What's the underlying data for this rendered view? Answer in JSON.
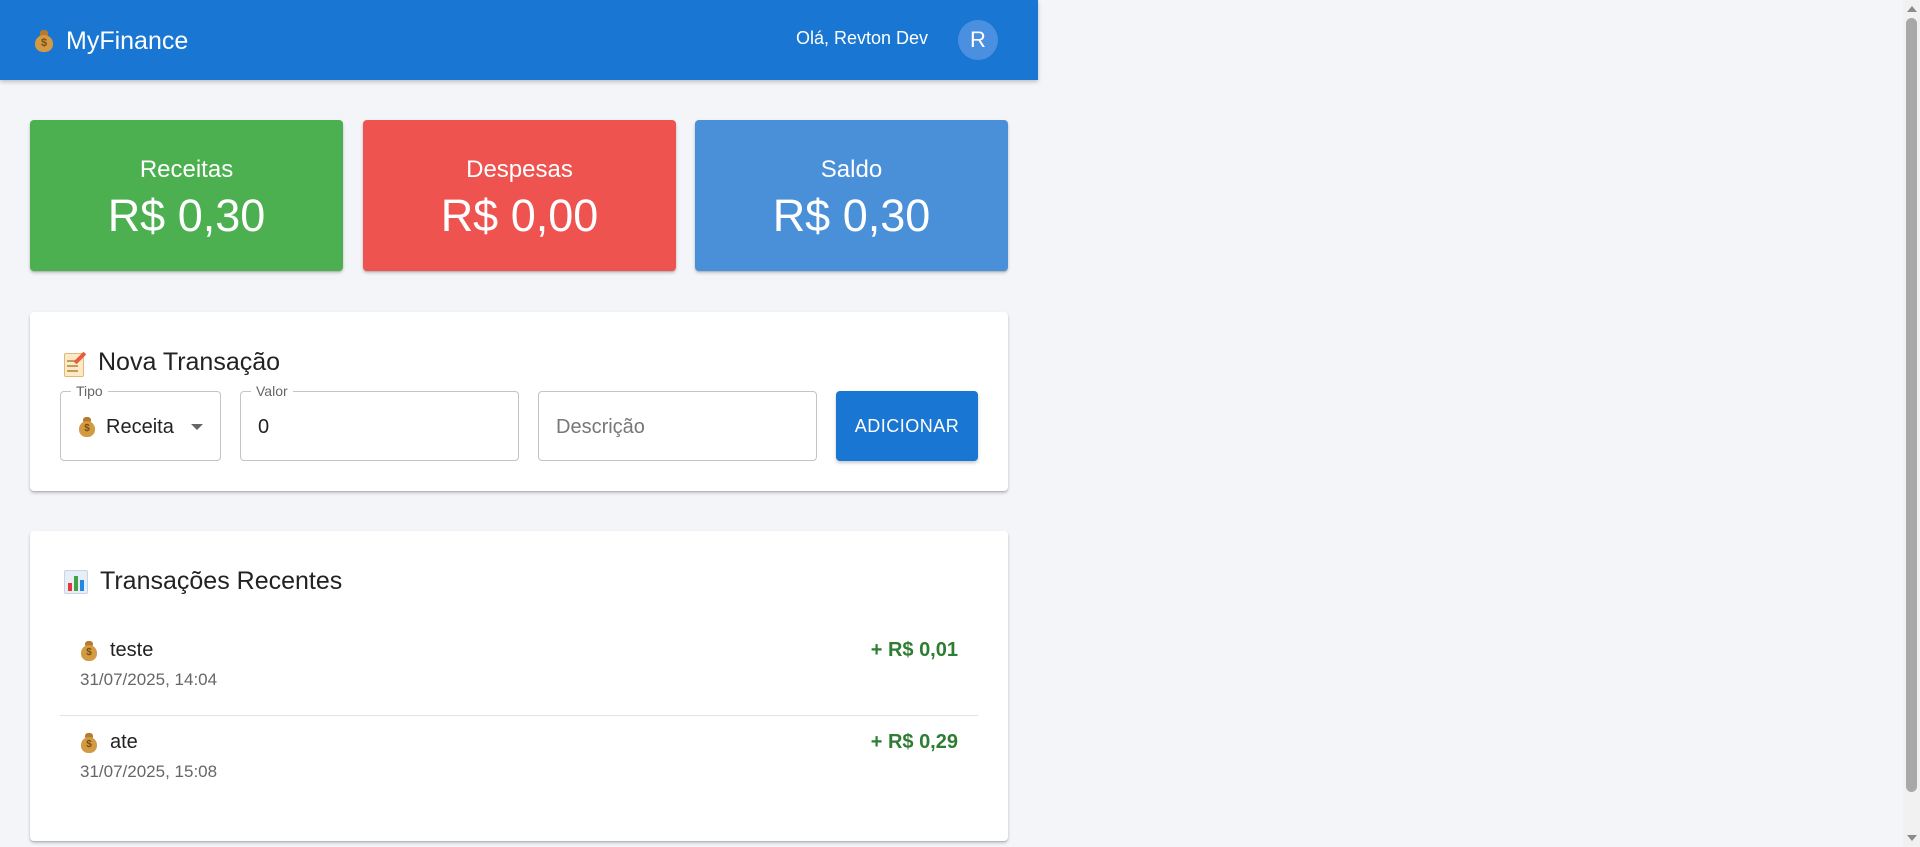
{
  "app": {
    "brand": "MyFinance",
    "brand_icon": "money-bag-icon"
  },
  "header": {
    "greeting": "Olá, Revton Dev",
    "avatar_initial": "R"
  },
  "summary": {
    "income": {
      "label": "Receitas",
      "value": "R$ 0,30",
      "color": "#4caf50"
    },
    "expense": {
      "label": "Despesas",
      "value": "R$ 0,00",
      "color": "#ef5350"
    },
    "balance": {
      "label": "Saldo",
      "value": "R$ 0,30",
      "color": "#4a90d9"
    }
  },
  "form": {
    "title": "Nova Transação",
    "title_icon": "memo-icon",
    "tipo": {
      "label": "Tipo",
      "value": "Receita",
      "icon": "money-bag-icon"
    },
    "valor": {
      "label": "Valor",
      "value": "0"
    },
    "descricao": {
      "placeholder": "Descrição",
      "value": ""
    },
    "submit_label": "ADICIONAR"
  },
  "transactions": {
    "title": "Transações Recentes",
    "title_icon": "bar-chart-icon",
    "items": [
      {
        "description": "teste",
        "date": "31/07/2025, 14:04",
        "amount": "+ R$ 0,01",
        "icon": "money-bag-icon"
      },
      {
        "description": "ate",
        "date": "31/07/2025, 15:08",
        "amount": "+ R$ 0,29",
        "icon": "money-bag-icon"
      }
    ]
  },
  "colors": {
    "primary": "#1976d2",
    "positive_amount": "#2e7d32",
    "background": "#f3f5f9"
  }
}
